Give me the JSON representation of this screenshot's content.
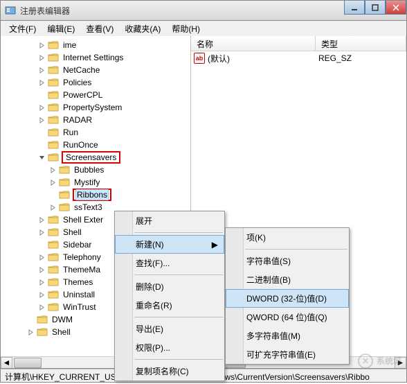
{
  "window": {
    "title": "注册表编辑器"
  },
  "menubar": {
    "file": "文件(F)",
    "edit": "编辑(E)",
    "view": "查看(V)",
    "favorites": "收藏夹(A)",
    "help": "帮助(H)"
  },
  "tree": {
    "items": [
      {
        "label": "ime",
        "indent": 3,
        "exp": "right"
      },
      {
        "label": "Internet Settings",
        "indent": 3,
        "exp": "right"
      },
      {
        "label": "NetCache",
        "indent": 3,
        "exp": "right"
      },
      {
        "label": "Policies",
        "indent": 3,
        "exp": "right"
      },
      {
        "label": "PowerCPL",
        "indent": 3,
        "exp": "none"
      },
      {
        "label": "PropertySystem",
        "indent": 3,
        "exp": "right"
      },
      {
        "label": "RADAR",
        "indent": 3,
        "exp": "right"
      },
      {
        "label": "Run",
        "indent": 3,
        "exp": "none"
      },
      {
        "label": "RunOnce",
        "indent": 3,
        "exp": "none"
      },
      {
        "label": "Screensavers",
        "indent": 3,
        "exp": "down",
        "redbox": true
      },
      {
        "label": "Bubbles",
        "indent": 4,
        "exp": "right"
      },
      {
        "label": "Mystify",
        "indent": 4,
        "exp": "right"
      },
      {
        "label": "Ribbons",
        "indent": 4,
        "exp": "none",
        "redbox": true,
        "selected": true
      },
      {
        "label": "ssText3",
        "indent": 4,
        "exp": "right"
      },
      {
        "label": "Shell Exter",
        "indent": 3,
        "exp": "right"
      },
      {
        "label": "Shell",
        "indent": 3,
        "exp": "right"
      },
      {
        "label": "Sidebar",
        "indent": 3,
        "exp": "none"
      },
      {
        "label": "Telephony",
        "indent": 3,
        "exp": "right"
      },
      {
        "label": "ThemeMa",
        "indent": 3,
        "exp": "right"
      },
      {
        "label": "Themes",
        "indent": 3,
        "exp": "right"
      },
      {
        "label": "Uninstall",
        "indent": 3,
        "exp": "right"
      },
      {
        "label": "WinTrust",
        "indent": 3,
        "exp": "right"
      },
      {
        "label": "DWM",
        "indent": 2,
        "exp": "none"
      },
      {
        "label": "Shell",
        "indent": 2,
        "exp": "right"
      }
    ]
  },
  "list": {
    "col_name": "名称",
    "col_type": "类型",
    "rows": [
      {
        "name": "(默认)",
        "type": "REG_SZ"
      }
    ]
  },
  "context_menu_main": {
    "expand": "展开",
    "new": "新建(N)",
    "find": "查找(F)...",
    "delete": "删除(D)",
    "rename": "重命名(R)",
    "export": "导出(E)",
    "permissions": "权限(P)...",
    "copy_key_name": "复制项名称(C)"
  },
  "context_menu_new": {
    "key": "项(K)",
    "string": "字符串值(S)",
    "binary": "二进制值(B)",
    "dword": "DWORD (32-位)值(D)",
    "qword": "QWORD (64 位)值(Q)",
    "multi_string": "多字符串值(M)",
    "expand_string": "可扩充字符串值(E)"
  },
  "statusbar": {
    "path": "计算机\\HKEY_CURRENT_USER\\Software\\Microsoft\\Windows\\CurrentVersion\\Screensavers\\Ribbo"
  },
  "watermark": "系统城"
}
